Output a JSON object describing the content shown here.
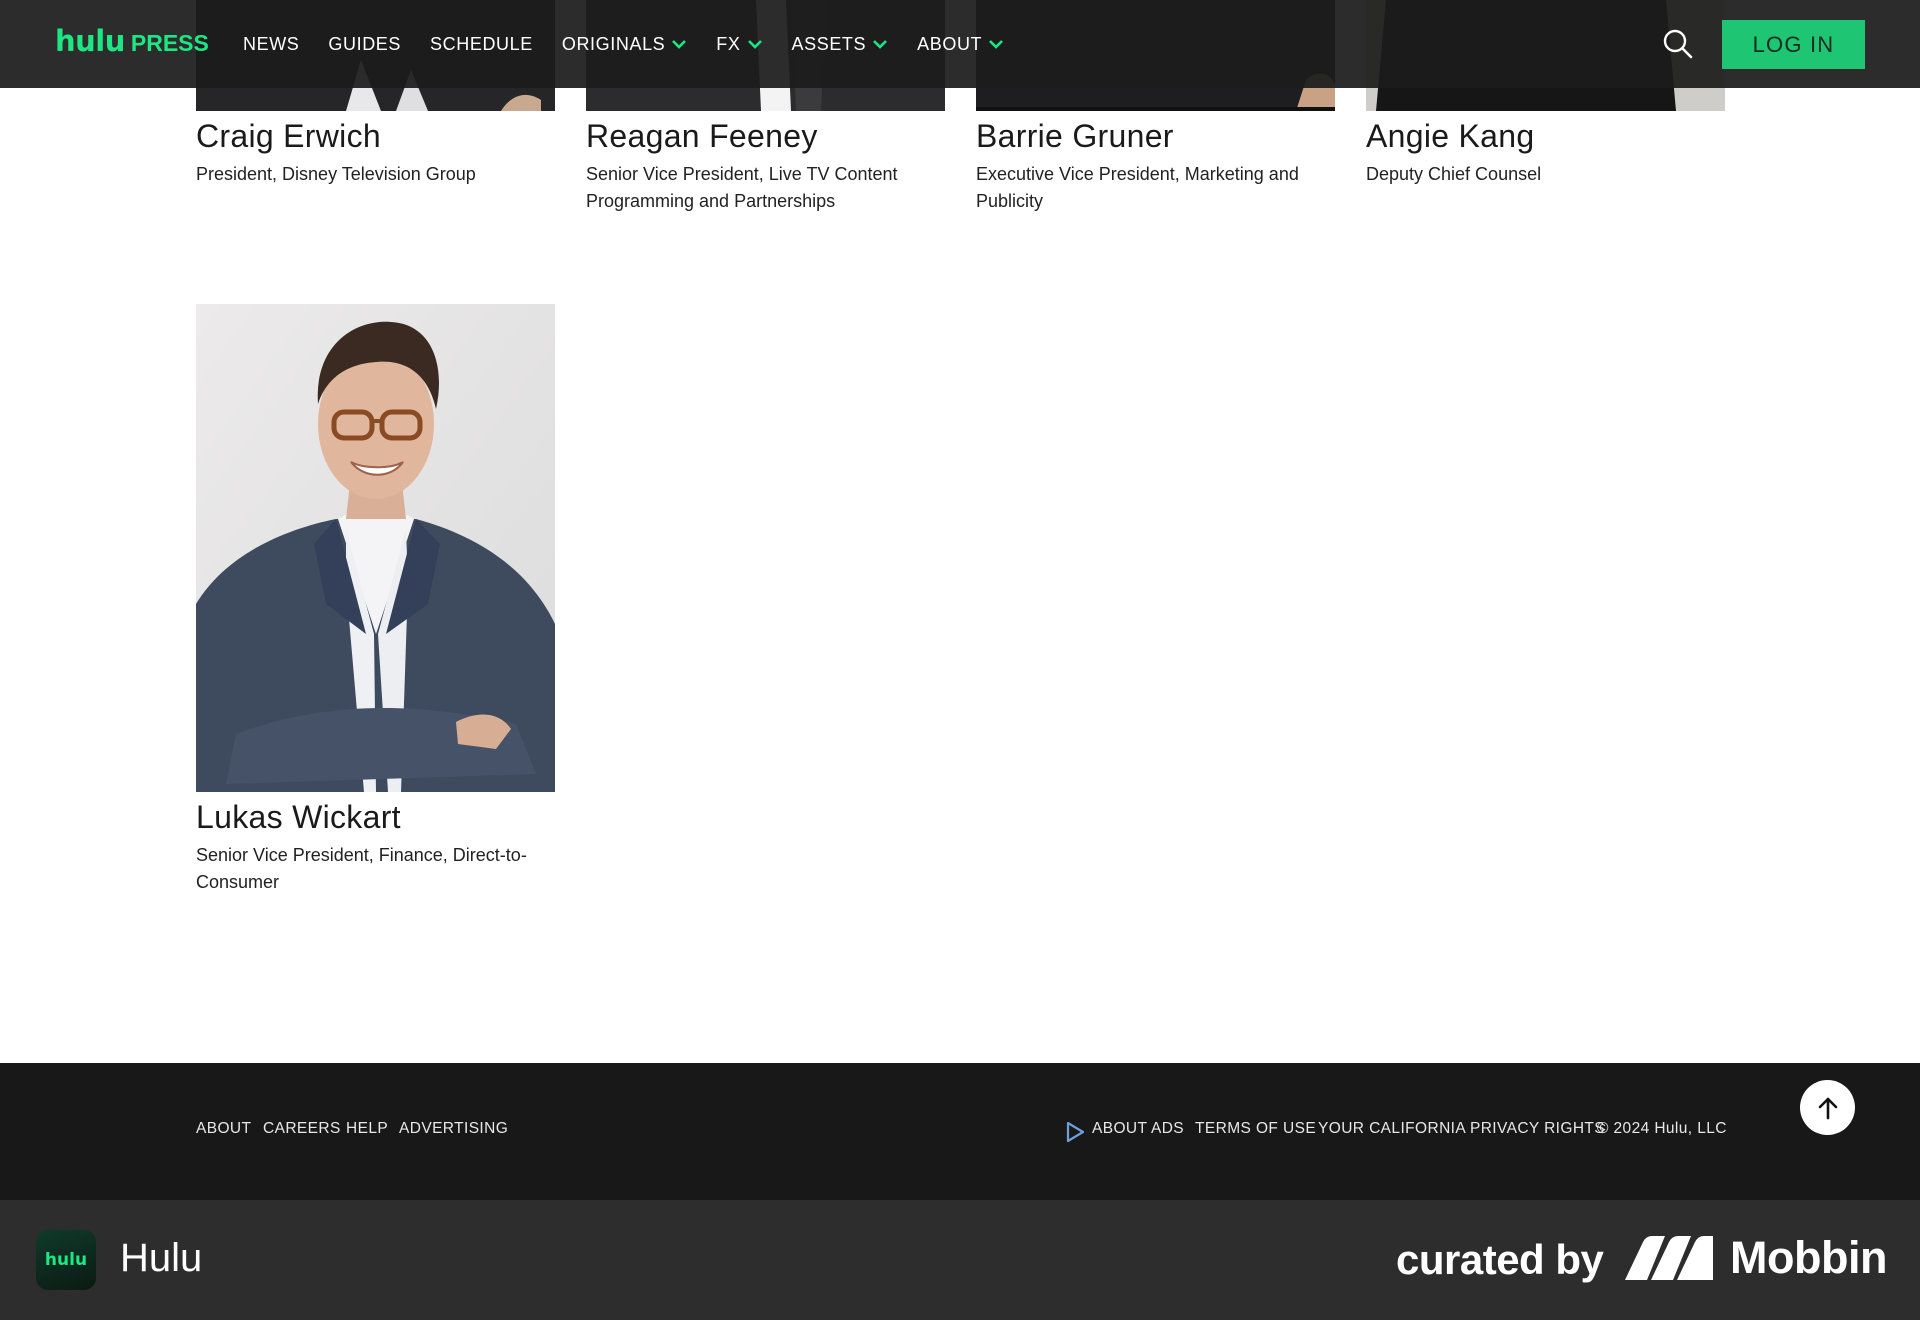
{
  "nav": {
    "logo_hulu": "hulu",
    "logo_press": "PRESS",
    "items": [
      {
        "label": "NEWS",
        "dropdown": false
      },
      {
        "label": "GUIDES",
        "dropdown": false
      },
      {
        "label": "SCHEDULE",
        "dropdown": false
      },
      {
        "label": "ORIGINALS",
        "dropdown": true
      },
      {
        "label": "FX",
        "dropdown": true
      },
      {
        "label": "ASSETS",
        "dropdown": true
      },
      {
        "label": "ABOUT",
        "dropdown": true
      }
    ],
    "search_icon": "search-icon",
    "login_label": "LOG IN"
  },
  "executives": [
    {
      "name": "Craig Erwich",
      "title_lines": [
        "President, Disney Television Group"
      ]
    },
    {
      "name": "Reagan Feeney",
      "title_lines": [
        "Senior Vice President, Live TV Content",
        "Programming and Partnerships"
      ]
    },
    {
      "name": "Barrie Gruner",
      "title_lines": [
        "Executive Vice President, Marketing and",
        "Publicity"
      ]
    },
    {
      "name": "Angie Kang",
      "title_lines": [
        "Deputy Chief Counsel"
      ]
    },
    {
      "name": "Lukas Wickart",
      "title_lines": [
        "Senior Vice President, Finance, Direct-to-",
        "Consumer"
      ]
    }
  ],
  "footer": {
    "left_links": [
      "ABOUT",
      "CAREERS",
      "HELP",
      "ADVERTISING"
    ],
    "about_ads": "ABOUT ADS",
    "terms": "TERMS OF USE",
    "privacy": "YOUR CALIFORNIA PRIVACY RIGHTS",
    "copyright": "© 2024 Hulu, LLC",
    "back_to_top_icon": "arrow-up-icon"
  },
  "mobbin": {
    "app_icon_text": "hulu",
    "app_name": "Hulu",
    "curated_by": "curated by",
    "brand": "Mobbin"
  },
  "colors": {
    "accent": "#1ce783",
    "nav_bg": "#1c1c1c",
    "footer_bg": "#181818",
    "mobbin_bar_bg": "#2d2d2d"
  }
}
